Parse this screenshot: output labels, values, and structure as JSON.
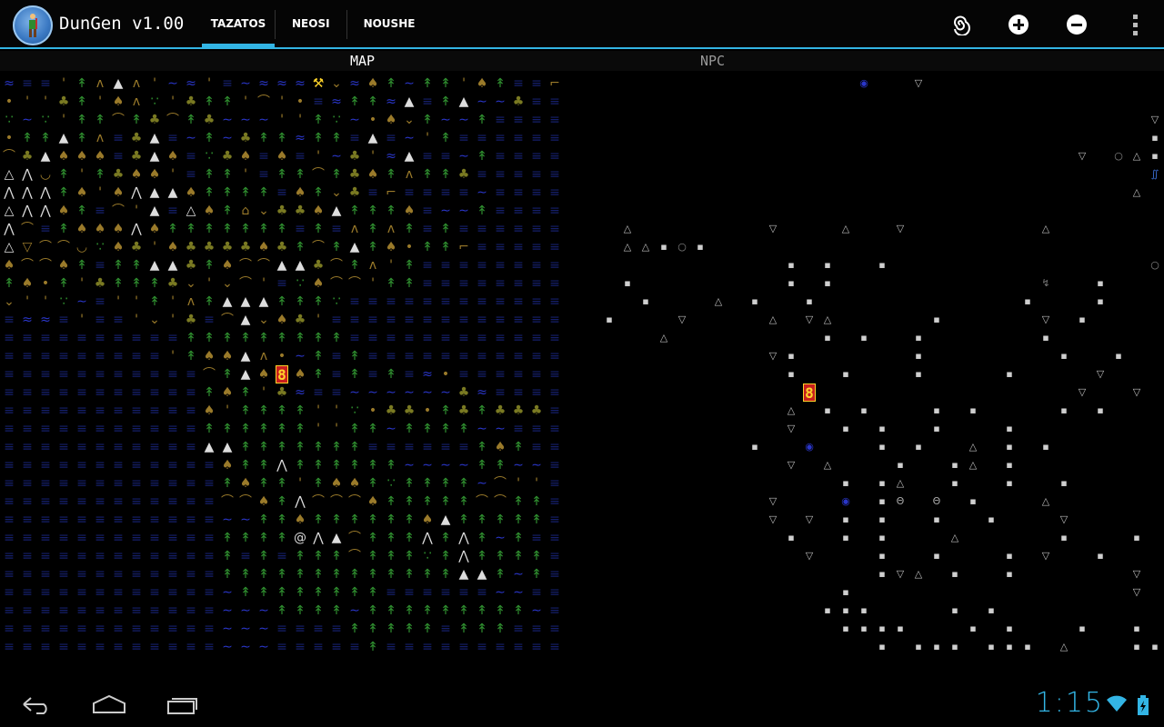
{
  "app": {
    "title": "DunGen v1.00"
  },
  "tabs": [
    {
      "label": "TAZATOS",
      "selected": true
    },
    {
      "label": "NEOSI",
      "selected": false
    },
    {
      "label": "NOUSHE",
      "selected": false
    }
  ],
  "actions": [
    {
      "icon": "spiral-icon"
    },
    {
      "icon": "zoom-in-icon"
    },
    {
      "icon": "zoom-out-icon"
    },
    {
      "icon": "overflow-menu-icon"
    }
  ],
  "panes": {
    "map_label": "MAP",
    "npc_label": "NPC"
  },
  "map": {
    "columns": 32,
    "rows": [
      "wWW'TaAa'~w'W~wwwXvwiT~TT'iTWW-",
      ".''tT'ia:'tTT'c'.WwTTwAWTA~~tWW",
      ":~:'TTcTtcTt~~~''T:~.ivT~~TWWWW",
      ".TTATaWtAW~T~tTTwTTWAW~'TWWWWWW",
      "ctAiiiWtAiW:tiWiW'~t'wAWW~TWWWW",
      "C^uT'Ttii'WTT'WTTcTtiTaTTtWWWWW",
      "^^^Ti'i^AAiTTTTWiTvtW-WWWW~WWWW",
      "C^^iTWc'AWCiTIvttiATTTiW~~TWWWW",
      "^cWTiii^iTTTTTTTWTWaTaTWTWWWWWW",
      "CVccu:it'ittttitTcTATi.TT-WWWWW",
      "icciTWTTAAtTiccAAtcTa'TWWWWWWWW",
      "Ti.T'tTTTtv'vc'W:icc'TTWWWWWWWW",
      "v'':~W''T'aTAAATTT:WWWWWWWWWWWW",
      "WwwW'WW'v'tWcAvit'WWWWWWWWWWWWW",
      "WWWWWWWWWWTTTTTTTTTWWWWWWWWWWWW",
      "WWWWWWWWW'TiiAa.~TWTWWWWWWWWWWW",
      "WWWWWWWWWWWcTAi8iTWTWTWw.WWWWWW",
      "WWWWWWWWWWWTiT'twWW~~~~~~twWWWW",
      "WWWWWWWWWWWi'TTTT'':.tt.TtTtttW",
      "WWWWWWWWWWWTTTTTT''TT~TTTT~~WWW",
      "WWWWWWWWWWWAATTTTTTTWWWWWWTiTWW",
      "WWWWWWWWWWWWiTT^TTTTTT~~~~TT~~W",
      "WWWWWWWWWWWWTiTT'TiiT:TTTT~c''W",
      "WWWWWWWWWWWWcciT^ccciTTTTTccTTW",
      "WWWWWWWWWWWW~~TTiTTTTTTiATTTTTW",
      "WWWWWWWWWWWWTTTT@^AcTTT^T^T~TWW",
      "WWWWWWWWWWWWTWTWTTTcTTT:T^TTTTW",
      "WWWWWWWWWWWWTTTTTTTTTTTTTAAT~TW",
      "WWWWWWWWWWWW~TTTTTTTTWWWWWW~~WW",
      "WWWWWWWWWWWW~~~TTTT~TTTTTTTTT~W",
      "WWWWWWWWWWWW~~~WWWWTTTTTWTTTWWW",
      "WWWWWWWWWWWW~~~WWWWWTWWWWWWWWWW"
    ]
  },
  "npc": {
    "columns": 32,
    "rows": [
      "...............@..V.............",
      "................................",
      "...............................V",
      "...............................:",
      "...........................V.oA:",
      "...............................J",
      "..............................A.",
      "...............................",
      "..A.......V...A..V.......A......",
      "..AA:o:..........................",
      "...........:.:..:..............o",
      "..:........:.:...........n..:...",
      "...:...A.:..:...........:...:...",
      ".:...V....A.VA.....:.....V.:....",
      "....A........:.:..:......:......",
      "..........V:......:.......:..:..",
      "...........:..:...:....:....V..",
      "............8..............V..V",
      "...........A.:.:...:.:....:.:..",
      "...........V..:.:..:...:.......",
      ".........:..@...:.:..A.:.:......",
      "...........V.A...:..:A.:.......",
      "..............:.:A..:..:..:....",
      "..........V...@.:O.O.:...A.....",
      "..........V.V.:.:..:..:...V....",
      "...........:..:.:...A.....:...:",
      "............V...:..:...:.V..:...",
      "................:VA.:..:......V.",
      "..............:...............V.",
      ".............:::....:.:.........",
      "..............::::...:.:...:..:.",
      "................:.:::.:::.A...::"
    ]
  },
  "navigation": [
    {
      "icon": "back-icon"
    },
    {
      "icon": "home-icon"
    },
    {
      "icon": "recent-apps-icon"
    }
  ],
  "status": {
    "time": "1:15",
    "wifi_icon": "wifi-icon",
    "battery_icon": "battery-icon"
  },
  "colors": {
    "accent": "#33b5e5",
    "water": "#2a36c9",
    "water_deep": "#151f6b",
    "tree_green": "#2f8f2f",
    "tree_olive": "#7a7a22",
    "brush": "#9a7a2a",
    "mountain": "#dddddd",
    "player_bg": "#c81e1e",
    "player_fg": "#ffd42a"
  }
}
